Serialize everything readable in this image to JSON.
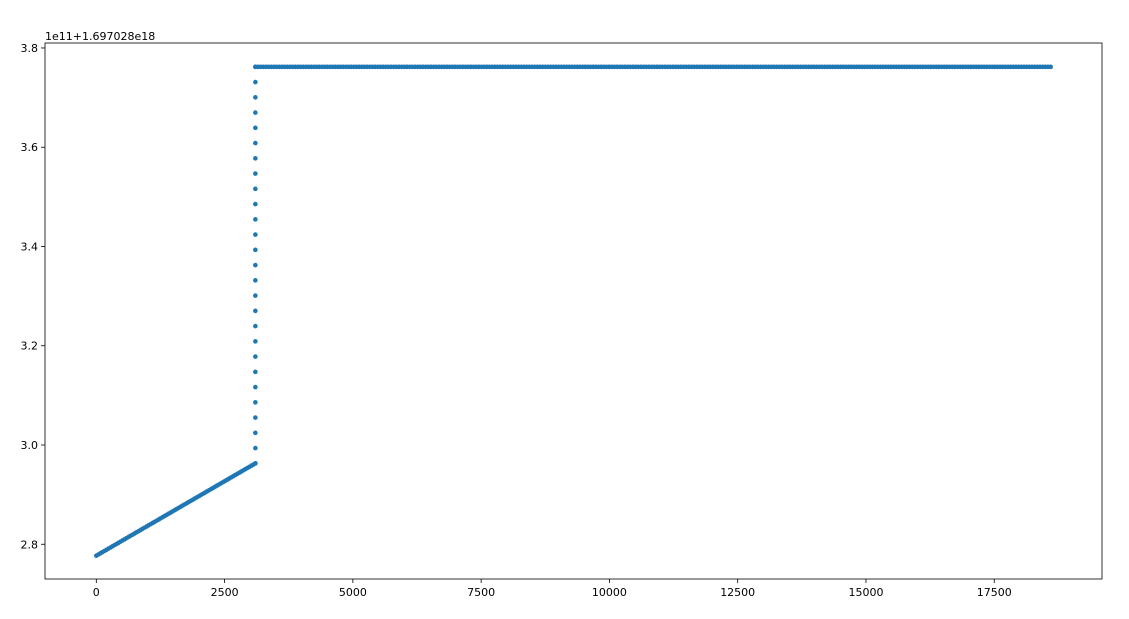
{
  "chart_data": {
    "type": "scatter",
    "title": "",
    "xlabel": "",
    "ylabel": "",
    "y_offset_label": "1e11+1.697028e18",
    "xlim": [
      -1000,
      19600
    ],
    "ylim": [
      2.73,
      3.81
    ],
    "x_ticks": [
      0,
      2500,
      5000,
      7500,
      10000,
      12500,
      15000,
      17500
    ],
    "x_tick_labels": [
      "0",
      "2500",
      "5000",
      "7500",
      "10000",
      "12500",
      "15000",
      "17500"
    ],
    "y_ticks": [
      2.8,
      3.0,
      3.2,
      3.4,
      3.6,
      3.8
    ],
    "y_tick_labels": [
      "2.8",
      "3.0",
      "3.2",
      "3.4",
      "3.6",
      "3.8"
    ],
    "grid": false,
    "marker_color": "#1f77b4",
    "series": [
      {
        "segments": [
          {
            "kind": "ramp",
            "x_start": 0,
            "x_end": 3100,
            "y_start": 2.777,
            "y_end": 2.963,
            "count": 80
          },
          {
            "kind": "jump",
            "x": 3100,
            "y_start": 2.963,
            "y_end": 3.762,
            "count": 26
          },
          {
            "kind": "plateau",
            "x_start": 3100,
            "x_end": 18600,
            "y": 3.762,
            "count": 300
          }
        ]
      }
    ]
  }
}
